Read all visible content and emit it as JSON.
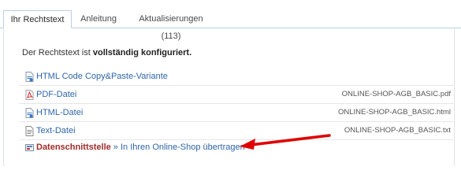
{
  "tabs": [
    {
      "label": "Ihr Rechtstext",
      "active": true
    },
    {
      "label": "Anleitung",
      "active": false
    },
    {
      "label": "Aktualisierungen (113)",
      "active": false
    }
  ],
  "intro": {
    "prefix": "Der Rechtstext ist ",
    "strong": "vollständig konfiguriert."
  },
  "rows": [
    {
      "icon": "html-file-icon",
      "label": "HTML Code Copy&Paste-Variante",
      "file": ""
    },
    {
      "icon": "pdf-file-icon",
      "label": "PDF-Datei",
      "file": "ONLINE-SHOP-AGB_BASIC.pdf"
    },
    {
      "icon": "html-file-icon",
      "label": "HTML-Datei",
      "file": "ONLINE-SHOP-AGB_BASIC.html"
    },
    {
      "icon": "text-file-icon",
      "label": "Text-Datei",
      "file": "ONLINE-SHOP-AGB_BASIC.txt"
    }
  ],
  "interface": {
    "icon": "interface-icon",
    "label_bold": "Datenschnittstelle",
    "label_rest": " » In Ihren Online-Shop übertragen"
  },
  "colors": {
    "link": "#2f66a8",
    "interface_label": "#a12a2a",
    "arrow": "#e00000",
    "tab_border": "#b9cfe3"
  },
  "annotation": {
    "icon": "red-arrow-icon"
  }
}
